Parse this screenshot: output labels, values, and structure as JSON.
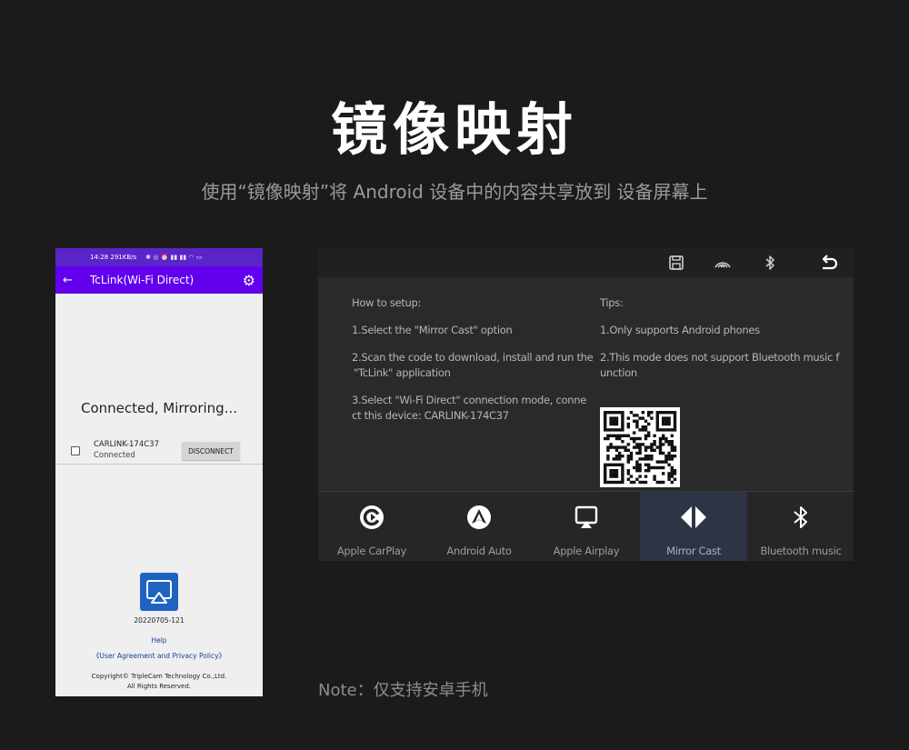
{
  "hero": {
    "title": "镜像映射",
    "subtitle": "使用“镜像映射”将 Android 设备中的内容共享放到 设备屏幕上"
  },
  "phone": {
    "status_bar": "14:28  291KB/s",
    "app_title": "TcLink(Wi-Fi Direct)",
    "status_text": "Connected, Mirroring...",
    "device": {
      "name": "CARLINK-174C37",
      "state": "Connected",
      "disconnect_label": "DISCONNECT"
    },
    "version": "20220705-121",
    "help_label": "Help",
    "agreement_label": "《User Agreement and Privacy Policy》",
    "copyright_line1": "Copyright© TripleCam Technology Co.,Ltd.",
    "copyright_line2": "All Rights Reserved.",
    "colors": {
      "appbar": "#6200ee",
      "logo": "#1e63c4"
    }
  },
  "head_unit": {
    "setup": {
      "heading": "How to setup:",
      "step1": "1.Select the \"Mirror Cast\" option",
      "step2a": "2.Scan the code to download, install and run the",
      "step2b": "\"TcLink\" application",
      "step3a": "3.Select \"Wi-Fi Direct\" connection mode, conne",
      "step3b": "ct this device: CARLINK-174C37"
    },
    "tips": {
      "heading": "Tips:",
      "tip1": "1.Only supports Android phones",
      "tip2a": "2.This mode does not support Bluetooth music f",
      "tip2b": "unction"
    },
    "topbar_icons": [
      "save-icon",
      "wireless-icon",
      "bluetooth-icon",
      "back-icon"
    ],
    "dock": [
      {
        "label": "Apple CarPlay",
        "icon": "carplay-icon"
      },
      {
        "label": "Android Auto",
        "icon": "android-auto-icon"
      },
      {
        "label": "Apple Airplay",
        "icon": "airplay-icon"
      },
      {
        "label": "Mirror Cast",
        "icon": "mirror-cast-icon",
        "active": true
      },
      {
        "label": "Bluetooth music",
        "icon": "bluetooth-music-icon"
      }
    ]
  },
  "note": "Note：仅支持安卓手机"
}
